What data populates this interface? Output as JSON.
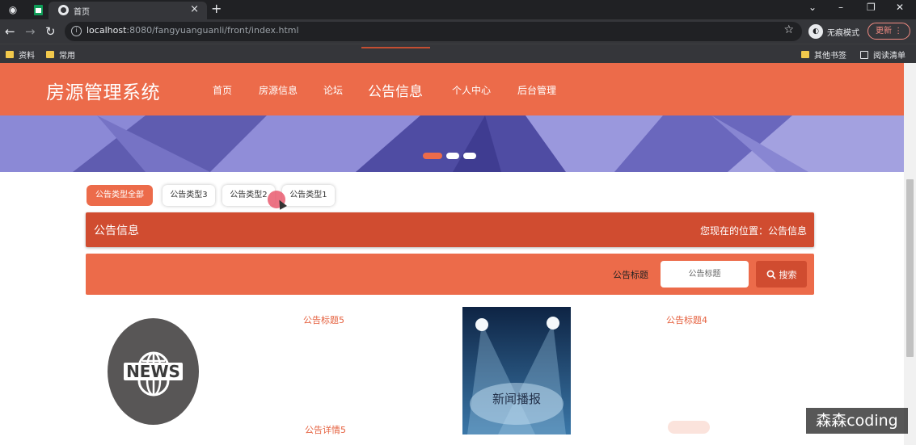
{
  "browser": {
    "tab_title": "首页",
    "url_host": "localhost",
    "url_rest": ":8080/fangyuanguanli/front/index.html",
    "incognito_label": "无痕模式",
    "update_label": "更新",
    "bookmarks": [
      "资料",
      "常用"
    ],
    "bookmarks_right": [
      "其他书签",
      "阅读清单"
    ]
  },
  "site": {
    "logo": "房源管理系统",
    "nav": [
      "首页",
      "房源信息",
      "论坛",
      "公告信息",
      "个人中心",
      "后台管理"
    ],
    "active_nav": "公告信息",
    "accent_color": "#ec6b4a",
    "accent_dark_color": "#d04c30"
  },
  "banner": {
    "slides_total": 3,
    "active_slide": 1
  },
  "filters": {
    "items": [
      "公告类型全部",
      "公告类型3",
      "公告类型2",
      "公告类型1"
    ],
    "selected": "公告类型全部"
  },
  "location_bar": {
    "title": "公告信息",
    "location": "您现在的位置：公告信息"
  },
  "search": {
    "label": "公告标题",
    "placeholder": "公告标题",
    "button_label": "搜索"
  },
  "cards": [
    {
      "image_text": "NEWS",
      "title": "公告标题5",
      "detail": "公告详情5"
    },
    {
      "image_text": "新闻播报",
      "title": "公告标题4"
    }
  ],
  "watermark": "森森coding"
}
